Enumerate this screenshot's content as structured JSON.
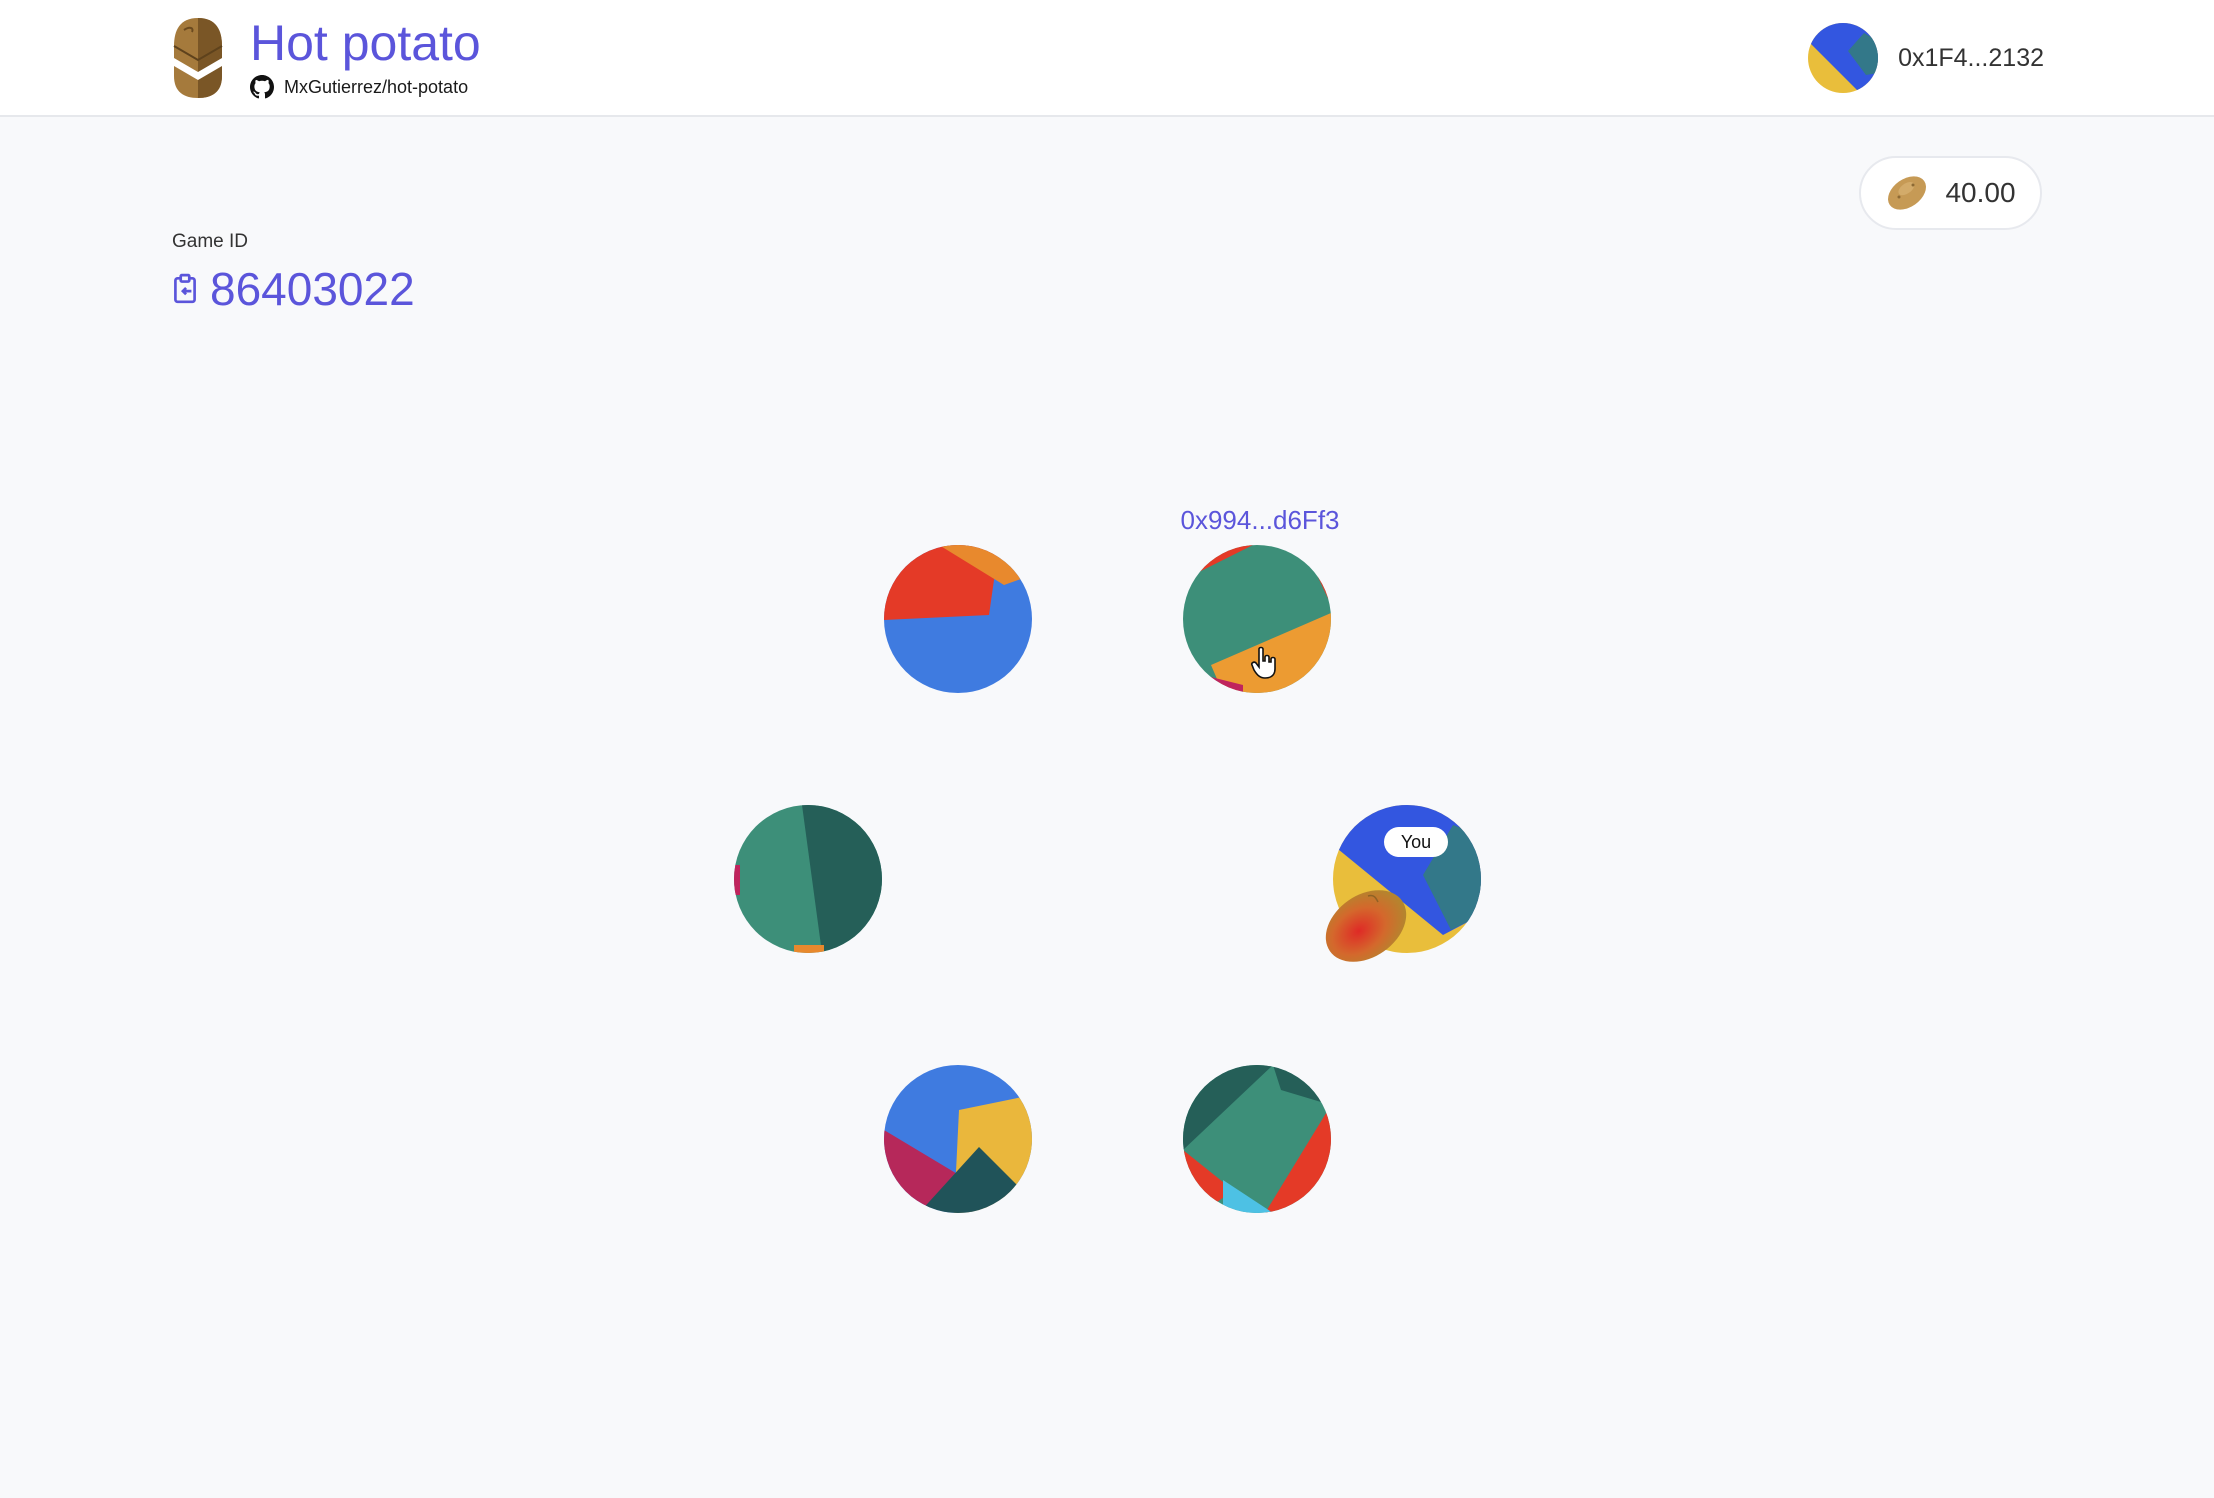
{
  "app": {
    "title": "Hot potato",
    "repo": "MxGutierrez/hot-potato",
    "logo_icon": "potato-logo-icon",
    "github_icon": "github-icon"
  },
  "account": {
    "address": "0x1F4...2132",
    "avatar_icon": "jazzicon-avatar"
  },
  "balance": {
    "value": "40.00",
    "icon": "potato-icon"
  },
  "game": {
    "id_label": "Game ID",
    "id": "86403022",
    "copy_icon": "clipboard-copy-icon"
  },
  "players": [
    {
      "position": "top-left",
      "colors": [
        "#3f7be0",
        "#e43a27",
        "#e8892d"
      ]
    },
    {
      "position": "top-right",
      "label": "0x994...d6Ff3",
      "colors": [
        "#3d8f79",
        "#ec9b32",
        "#e43a27",
        "#c0245d"
      ]
    },
    {
      "position": "left",
      "colors": [
        "#3d8f79",
        "#255f58",
        "#c0245d"
      ]
    },
    {
      "position": "right",
      "badge": "You",
      "holds_potato": true,
      "colors": [
        "#3356e0",
        "#e9be3b",
        "#337889"
      ]
    },
    {
      "position": "bottom-left",
      "colors": [
        "#3f7be0",
        "#eab73c",
        "#205359",
        "#b6285a"
      ]
    },
    {
      "position": "bottom-right",
      "colors": [
        "#3d8f79",
        "#255f58",
        "#e43a27",
        "#4dc1e4"
      ]
    }
  ],
  "colors": {
    "accent": "#5b55db",
    "background": "#f8f9fb"
  }
}
